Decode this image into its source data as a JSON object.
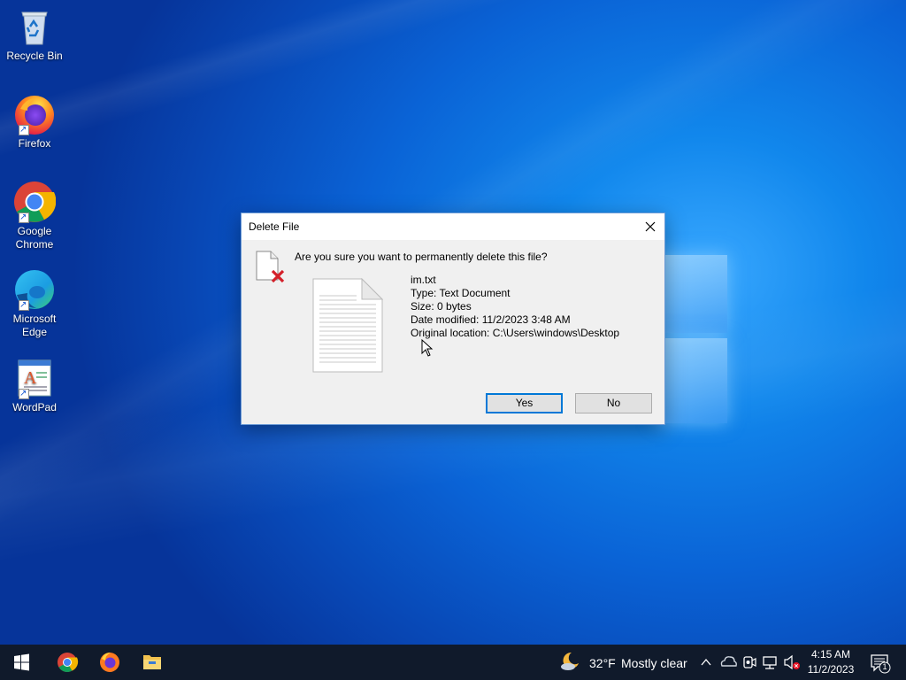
{
  "desktop": {
    "icons": [
      {
        "label": "Recycle Bin",
        "icon": "recycle-bin-icon"
      },
      {
        "label": "Firefox",
        "icon": "firefox-icon"
      },
      {
        "label": "Google Chrome",
        "icon": "chrome-icon"
      },
      {
        "label": "Microsoft Edge",
        "icon": "edge-icon"
      },
      {
        "label": "WordPad",
        "icon": "wordpad-icon"
      }
    ]
  },
  "dialog": {
    "title": "Delete File",
    "question": "Are you sure you want to permanently delete this file?",
    "file": {
      "name": "im.txt",
      "type": "Type: Text Document",
      "size": "Size: 0 bytes",
      "modified": "Date modified: 11/2/2023 3:48 AM",
      "location": "Original location: C:\\Users\\windows\\Desktop"
    },
    "buttons": {
      "yes": "Yes",
      "no": "No"
    },
    "close_icon": "close-icon"
  },
  "taskbar": {
    "pinned": [
      "start-icon",
      "chrome-icon",
      "firefox-icon",
      "file-explorer-icon"
    ],
    "weather": {
      "temp": "32°F",
      "condition": "Mostly clear",
      "icon": "moon-cloud-icon"
    },
    "tray_icons": [
      "chevron-up-icon",
      "onedrive-icon",
      "meet-now-icon",
      "network-icon",
      "volume-muted-icon"
    ],
    "clock": {
      "time": "4:15 AM",
      "date": "11/2/2023"
    },
    "notifications": {
      "count": "1",
      "icon": "notification-icon"
    }
  },
  "colors": {
    "accent": "#0078d7",
    "taskbar": "#101a2b",
    "delete_x": "#d4202a"
  }
}
